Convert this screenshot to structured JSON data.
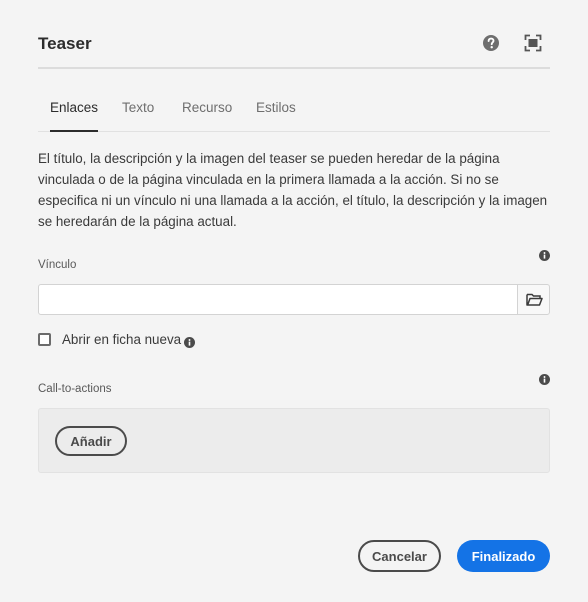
{
  "dialog": {
    "title": "Teaser",
    "help_icon": "help-icon",
    "fullscreen_icon": "fullscreen-icon"
  },
  "tabs": [
    {
      "label": "Enlaces",
      "active": true
    },
    {
      "label": "Texto",
      "active": false
    },
    {
      "label": "Recurso",
      "active": false
    },
    {
      "label": "Estilos",
      "active": false
    }
  ],
  "links_tab": {
    "description": "El título, la descripción y la imagen del teaser se pueden heredar de la página vinculada o de la página vinculada en la primera llamada a la acción. Si no se especifica ni un vínculo ni una llamada a la acción, el título, la descripción y la imagen se heredarán de la página actual.",
    "link_label": "Vínculo",
    "link_value": "",
    "browse_icon": "folder-open-icon",
    "new_tab_label": "Abrir en ficha nueva",
    "new_tab_checked": false,
    "cta_label": "Call-to-actions",
    "add_label": "Añadir",
    "info_icon": "info-icon"
  },
  "footer": {
    "cancel_label": "Cancelar",
    "done_label": "Finalizado"
  },
  "colors": {
    "accent": "#1473e6",
    "background": "#f4f4f4",
    "text": "#2c2c2c"
  }
}
